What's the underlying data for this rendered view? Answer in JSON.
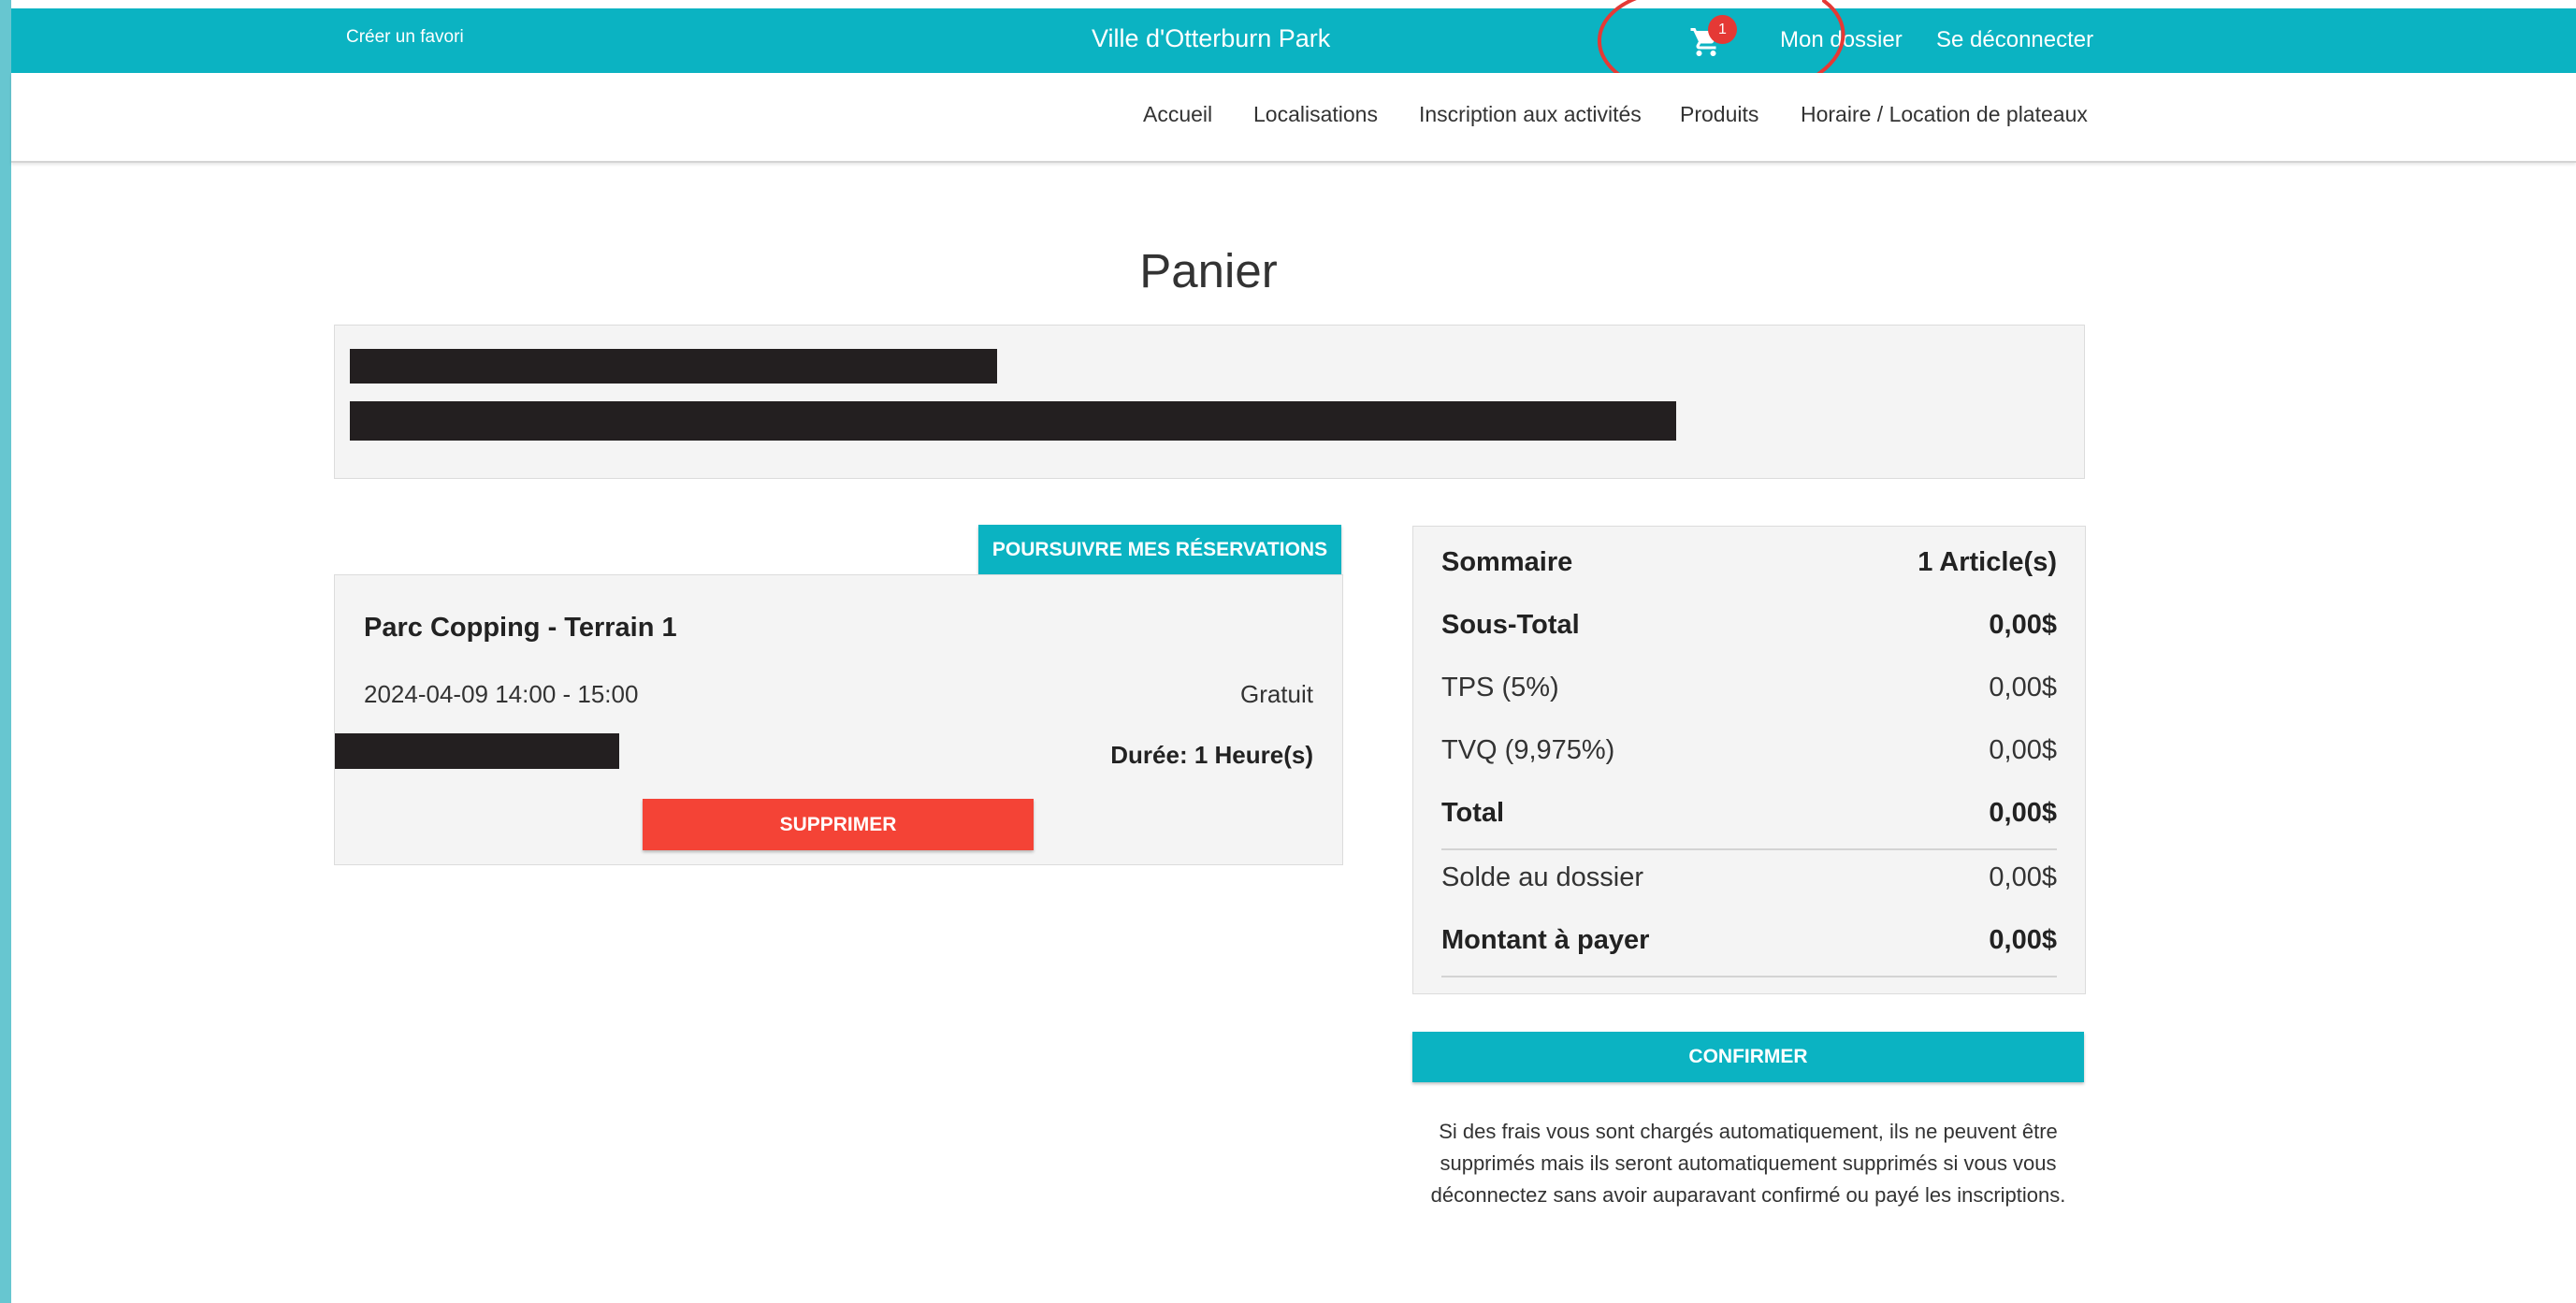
{
  "header": {
    "favorite_link": "Créer un favori",
    "site_title": "Ville d'Otterburn Park",
    "cart_icon": "cart-icon",
    "cart_count": "1",
    "my_account": "Mon dossier",
    "logout": "Se déconnecter"
  },
  "nav": {
    "items": [
      "Accueil",
      "Localisations",
      "Inscription aux activités",
      "Produits",
      "Horaire / Location de plateaux"
    ]
  },
  "page": {
    "title": "Panier"
  },
  "actions": {
    "continue_label": "POURSUIVRE MES RÉSERVATIONS"
  },
  "item": {
    "name": "Parc Copping - Terrain 1",
    "datetime": "2024-04-09 14:00 - 15:00",
    "price": "Gratuit",
    "duration": "Durée: 1 Heure(s)",
    "delete_label": "SUPPRIMER"
  },
  "summary": {
    "title": "Sommaire",
    "count": "1 Article(s)",
    "rows": [
      {
        "label": "Sous-Total",
        "value": "0,00$"
      },
      {
        "label": "TPS (5%)",
        "value": "0,00$"
      },
      {
        "label": "TVQ (9,975%)",
        "value": "0,00$"
      },
      {
        "label": "Total",
        "value": "0,00$"
      },
      {
        "label": "Solde au dossier",
        "value": "0,00$"
      },
      {
        "label": "Montant à payer",
        "value": "0,00$"
      }
    ]
  },
  "confirm_label": "CONFIRMER",
  "disclaimer": "Si des frais vous sont chargés automatiquement, ils ne peuvent être supprimés mais ils seront automatiquement supprimés si vous vous déconnectez sans avoir auparavant confirmé ou payé les inscriptions.",
  "colors": {
    "primary": "#0bb3c2",
    "danger": "#f44336",
    "badge": "#e53935",
    "annotation": "#e53935"
  }
}
